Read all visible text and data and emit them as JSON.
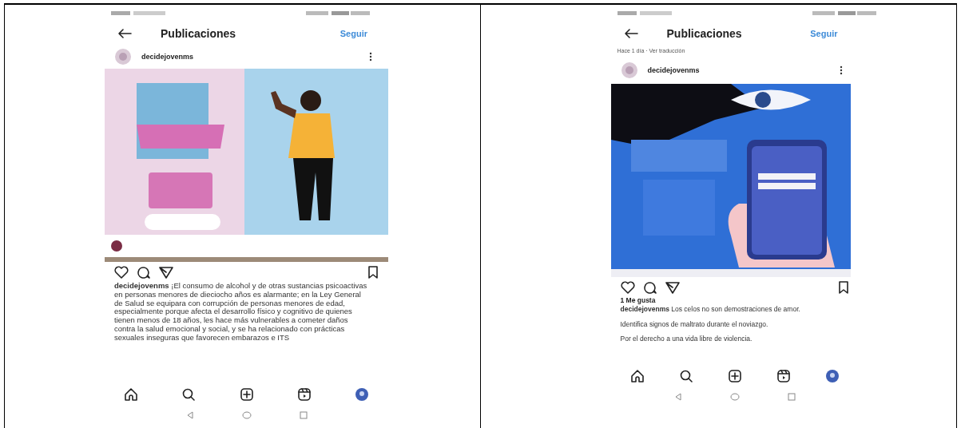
{
  "panels": [
    {
      "header": {
        "title": "Publicaciones",
        "action": "Seguir"
      },
      "account": {
        "username": "decidejovenms"
      },
      "post": {
        "kind": "picture"
      },
      "caption": [
        "**decidejovenms** ¡El consumo de alcohol y de otras sustancias psicoactivas en personas menores de dieciocho años es alarmante; en la Ley General de Salud se equipara con corrupción de personas menores de edad, especialmente porque afecta el desarrollo físico y cognitivo de quienes tienen menos de 18 años, les hace más vulnerables a cometer daños contra la salud emocional y social, y se ha relacionado con prácticas sexuales inseguras que favorecen embarazos e ITS"
      ]
    },
    {
      "header": {
        "title": "Publicaciones",
        "action": "Seguir"
      },
      "meta": "Hace 1 día · Ver traducción",
      "account": {
        "username": "decidejovenms"
      },
      "post": {
        "kind": "picture"
      },
      "likes": "1 Me gusta",
      "caption": [
        "**decidejovenms** Los celos no son demostraciones de amor.",
        "Identifica signos de maltrato durante el noviazgo.",
        "Por el derecho a una vida libre de violencia."
      ]
    }
  ]
}
